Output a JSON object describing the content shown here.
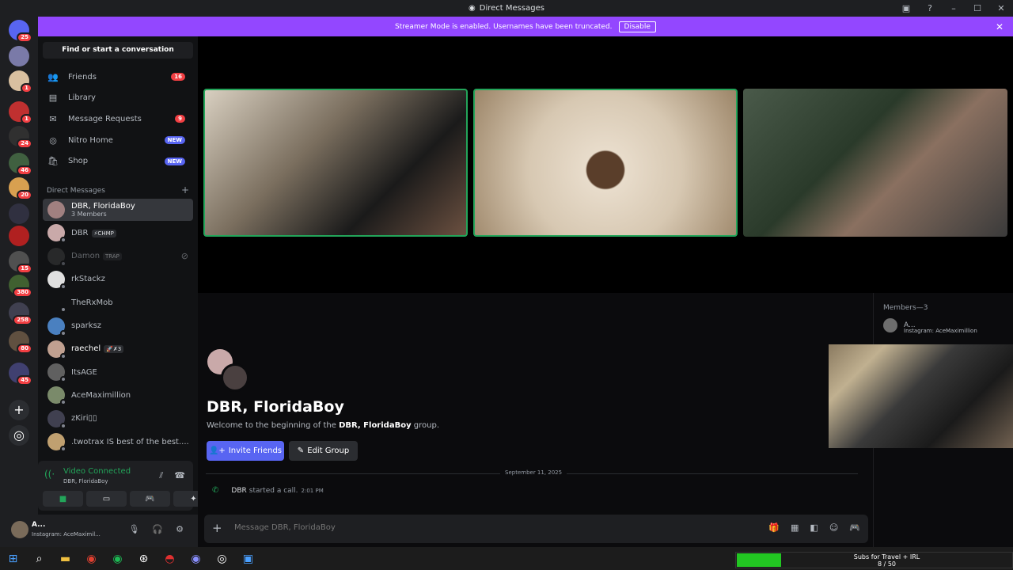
{
  "window": {
    "title": "Direct Messages"
  },
  "banner": {
    "text": "Streamer Mode is enabled. Usernames have been truncated.",
    "button": "Disable"
  },
  "servers": [
    {
      "badge": "25",
      "color": "#5865f2"
    },
    {
      "badge": "",
      "color": "#7a7aa8"
    },
    {
      "badge": "1",
      "color": "#d9c0a0"
    },
    {
      "badge": "1",
      "color": "#c03030"
    },
    {
      "badge": "24",
      "color": "#303030"
    },
    {
      "badge": "46",
      "color": "#406040"
    },
    {
      "badge": "20",
      "color": "#d8a050"
    },
    {
      "badge": "",
      "color": "#303040"
    },
    {
      "badge": "",
      "color": "#b02020"
    },
    {
      "badge": "15",
      "color": "#505050"
    },
    {
      "badge": "380",
      "color": "#406030"
    },
    {
      "badge": "258",
      "color": "#404050"
    },
    {
      "badge": "80",
      "color": "#605040"
    },
    {
      "badge": "45",
      "color": "#404070"
    }
  ],
  "sidebar": {
    "find_label": "Find or start a conversation",
    "nav": [
      {
        "label": "Friends",
        "icon": "👥",
        "badge": "16",
        "new": false
      },
      {
        "label": "Library",
        "icon": "▤",
        "badge": "",
        "new": false
      },
      {
        "label": "Message Requests",
        "icon": "✉",
        "badge": "9",
        "new": false
      },
      {
        "label": "Nitro Home",
        "icon": "◎",
        "badge": "NEW",
        "new": true
      },
      {
        "label": "Shop",
        "icon": "🛍",
        "badge": "NEW",
        "new": true
      }
    ],
    "dm_header": "Direct Messages",
    "dms": [
      {
        "name": "DBR, FloridaBoy",
        "sub": "3 Members",
        "tag": "",
        "color": "#a08080"
      },
      {
        "name": "DBR",
        "sub": "",
        "tag": "⚡CHMP",
        "color": "#c9a9a9"
      },
      {
        "name": "Damon",
        "sub": "",
        "tag": "TRAP",
        "color": "#404040"
      },
      {
        "name": "rkStackz",
        "sub": "",
        "tag": "",
        "color": "#e0e0e0"
      },
      {
        "name": "TheRxMob",
        "sub": "",
        "tag": "",
        "color": "#111214"
      },
      {
        "name": "sparksz",
        "sub": "",
        "tag": "",
        "color": "#4a80c0"
      },
      {
        "name": "raechel",
        "sub": "",
        "tag": "🚀✗3",
        "color": "#c0a090"
      },
      {
        "name": "ItsAGE",
        "sub": "",
        "tag": "",
        "color": "#606060"
      },
      {
        "name": "AceMaximillion",
        "sub": "",
        "tag": "",
        "color": "#7a8a6a"
      },
      {
        "name": "zKiri▯▯",
        "sub": "",
        "tag": "",
        "color": "#404050"
      },
      {
        "name": ".twotrax IS best of the best....",
        "sub": "",
        "tag": "",
        "color": "#c0a070"
      }
    ]
  },
  "voice": {
    "status": "Video Connected",
    "channel": "DBR, FloridaBoy"
  },
  "user": {
    "name": "A...",
    "status": "Instagram: AceMaximil..."
  },
  "chat": {
    "group_title": "DBR, FloridaBoy",
    "welcome_prefix": "Welcome to the beginning of the",
    "welcome_name": "DBR, FloridaBoy",
    "welcome_suffix": "group.",
    "invite_label": "Invite Friends",
    "edit_label": "Edit Group",
    "date": "September 11, 2025",
    "call_user": "DBR",
    "call_text": "started a call.",
    "call_time": "2:01 PM",
    "composer_placeholder": "Message DBR, FloridaBoy"
  },
  "members": {
    "header": "Members—3",
    "list": [
      {
        "name": "A...",
        "status": "Instagram: AceMaximillion"
      }
    ]
  },
  "subs_goal": {
    "title": "Subs for Travel + IRL",
    "count": "8 / 50",
    "fraction": 0.16
  }
}
